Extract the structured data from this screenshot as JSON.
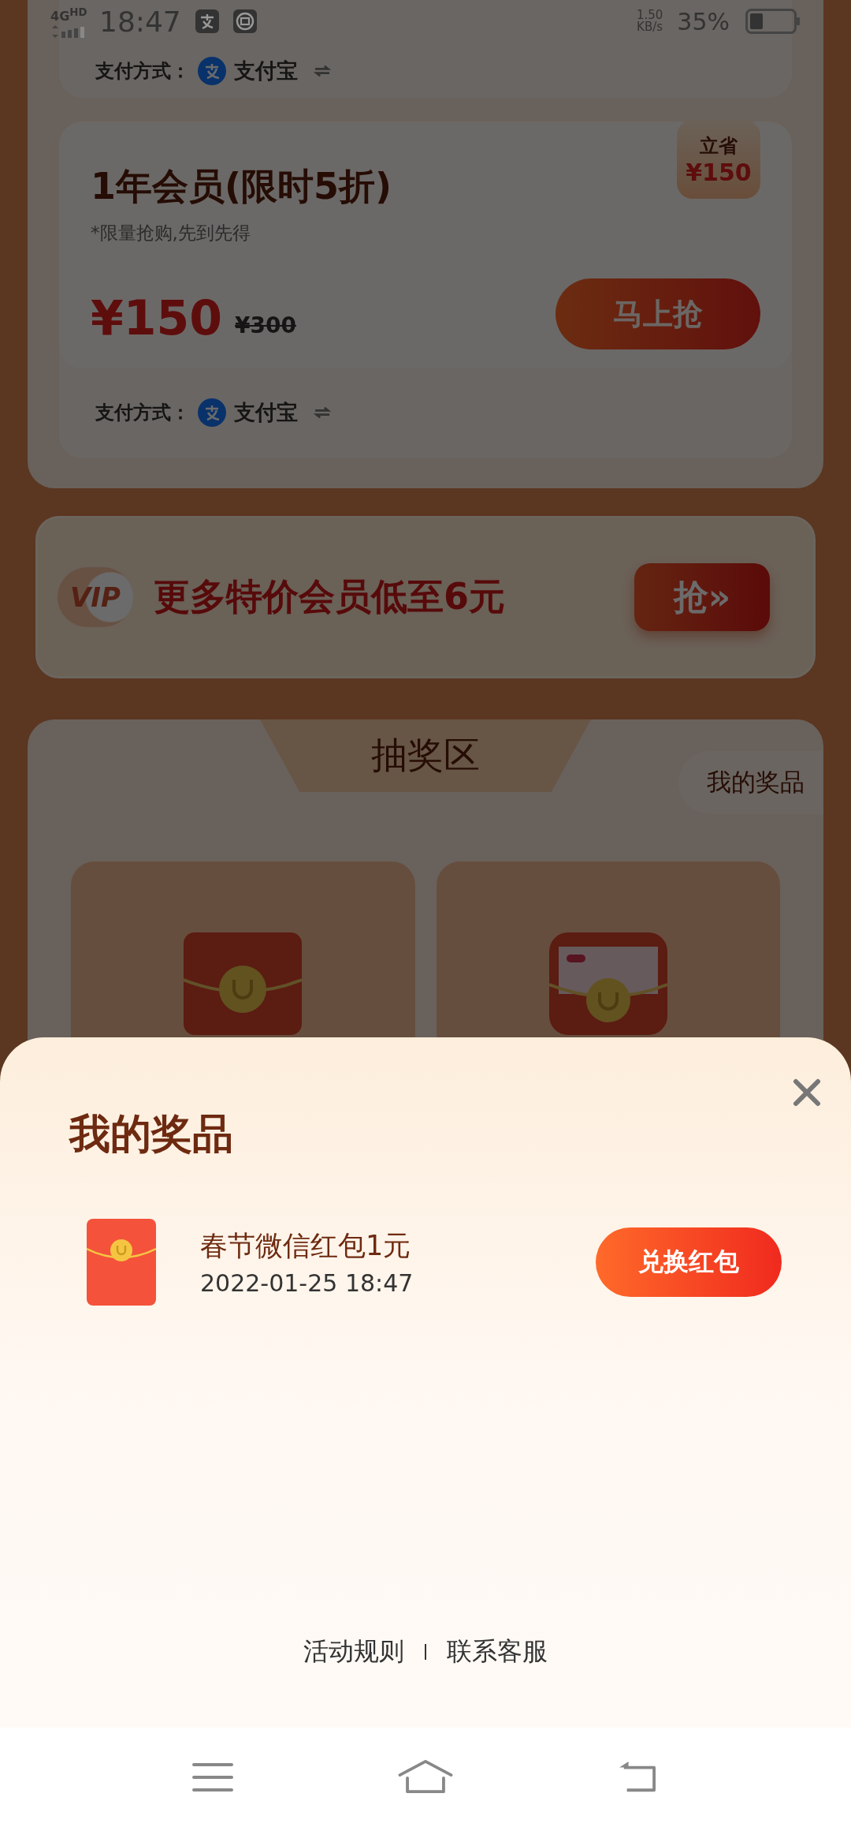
{
  "status_bar": {
    "network": "4G$^{HD}$",
    "time": "18:47",
    "speed_value": "1.50",
    "speed_unit": "KB/s",
    "battery": "35%"
  },
  "top_card": {
    "pay_label": "支付方式：",
    "pay_method": "支付宝"
  },
  "offer_card": {
    "title": "1年会员(限时5折)",
    "note": "*限量抢购,先到先得",
    "price": "¥150",
    "original_price": "¥300",
    "buy_button": "马上抢",
    "saving": {
      "label": "立省",
      "amount": "¥150"
    },
    "pay_label": "支付方式：",
    "pay_method": "支付宝"
  },
  "banner": {
    "badge": "VIP",
    "text": "更多特价会员低至6元",
    "button": "抢»"
  },
  "lottery": {
    "title": "抽奖区",
    "my_prizes_button": "我的奖品",
    "cards": [
      {
        "kind": "envelope"
      },
      {
        "kind": "cash_envelope"
      }
    ]
  },
  "prize_sheet": {
    "title": "我的奖品",
    "prizes": [
      {
        "name": "春节微信红包1元",
        "date": "2022-01-25 18:47",
        "button": "兑换红包"
      }
    ],
    "footer_links": [
      "活动规则",
      "联系客服"
    ]
  }
}
